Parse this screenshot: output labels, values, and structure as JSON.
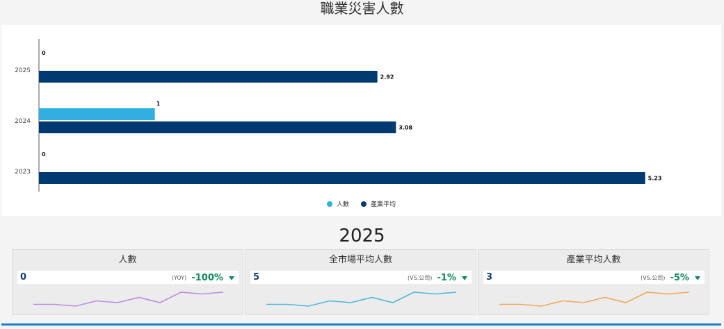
{
  "page": {
    "title": "職業災害人數"
  },
  "chart_data": {
    "type": "bar",
    "orientation": "horizontal",
    "categories": [
      "2025",
      "2024",
      "2023"
    ],
    "series": [
      {
        "name": "人數",
        "values": [
          0,
          1,
          0
        ],
        "labels": [
          "0",
          "1",
          "0"
        ],
        "color": "#2fb0e0"
      },
      {
        "name": "產業平均",
        "values": [
          2.92,
          3.08,
          5.23
        ],
        "labels": [
          "2.92",
          "3.08",
          "5.23"
        ],
        "color": "#003a70"
      }
    ],
    "xlim": [
      0,
      6.0
    ],
    "legend_position": "bottom-center",
    "grid": false
  },
  "summary": {
    "year": "2025",
    "cards": [
      {
        "title": "人數",
        "value": "0",
        "compare_label": "(YOY)",
        "compare_pct": "-100%",
        "trend": "down",
        "spark_color": "#b98be6",
        "spark": [
          3,
          3,
          2,
          5,
          4,
          7,
          4,
          10,
          9,
          10
        ]
      },
      {
        "title": "全市場平均人數",
        "value": "5",
        "compare_label": "(VS.公司)",
        "compare_pct": "-1%",
        "trend": "down",
        "spark_color": "#4fb8df",
        "spark": [
          3,
          3,
          2,
          5,
          4,
          7,
          4,
          10,
          9,
          10
        ]
      },
      {
        "title": "產業平均人數",
        "value": "3",
        "compare_label": "(VS.公司)",
        "compare_pct": "-5%",
        "trend": "down",
        "spark_color": "#f2a65a",
        "spark": [
          3,
          3,
          2,
          5,
          4,
          7,
          4,
          10,
          9,
          10
        ]
      }
    ],
    "compare_color": "#138a5b"
  }
}
